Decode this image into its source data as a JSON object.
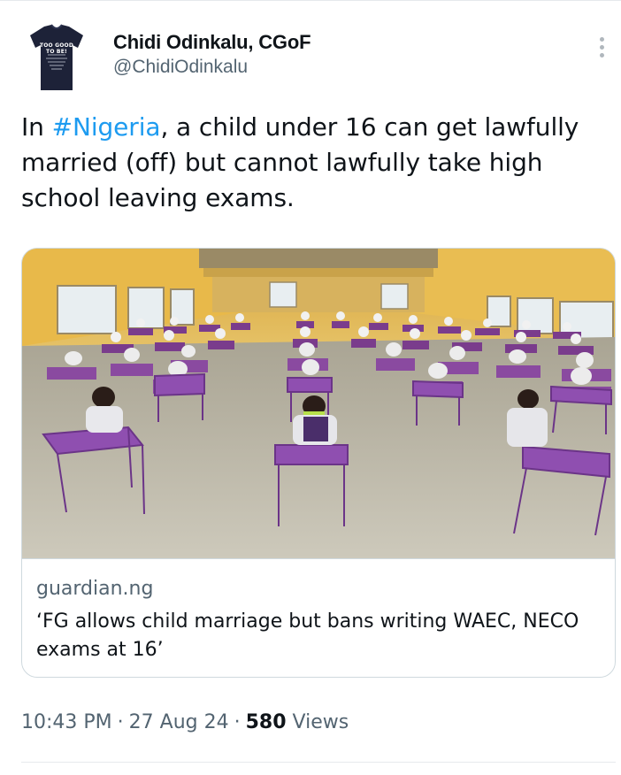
{
  "author": {
    "display_name": "Chidi Odinkalu, CGoF",
    "handle": "@ChidiOdinkalu",
    "avatar_text": "TOO GOOD TO BE!"
  },
  "tweet": {
    "text_prefix": "In ",
    "hashtag": "#Nigeria",
    "text_suffix": ", a child under 16 can get lawfully married (off) but cannot lawfully take high school leaving exams."
  },
  "link_card": {
    "domain": "guardian.ng",
    "title": "‘FG allows child marriage but bans writing WAEC, NECO exams at 16’"
  },
  "meta": {
    "time": "10:43 PM",
    "date": "27 Aug 24",
    "views_count": "580",
    "views_label": "Views",
    "separator": "·"
  },
  "icons": {
    "more": "more-vertical-icon"
  },
  "colors": {
    "hashtag": "#1d9bf0",
    "secondary_text": "#536471",
    "primary_text": "#0f1419"
  }
}
